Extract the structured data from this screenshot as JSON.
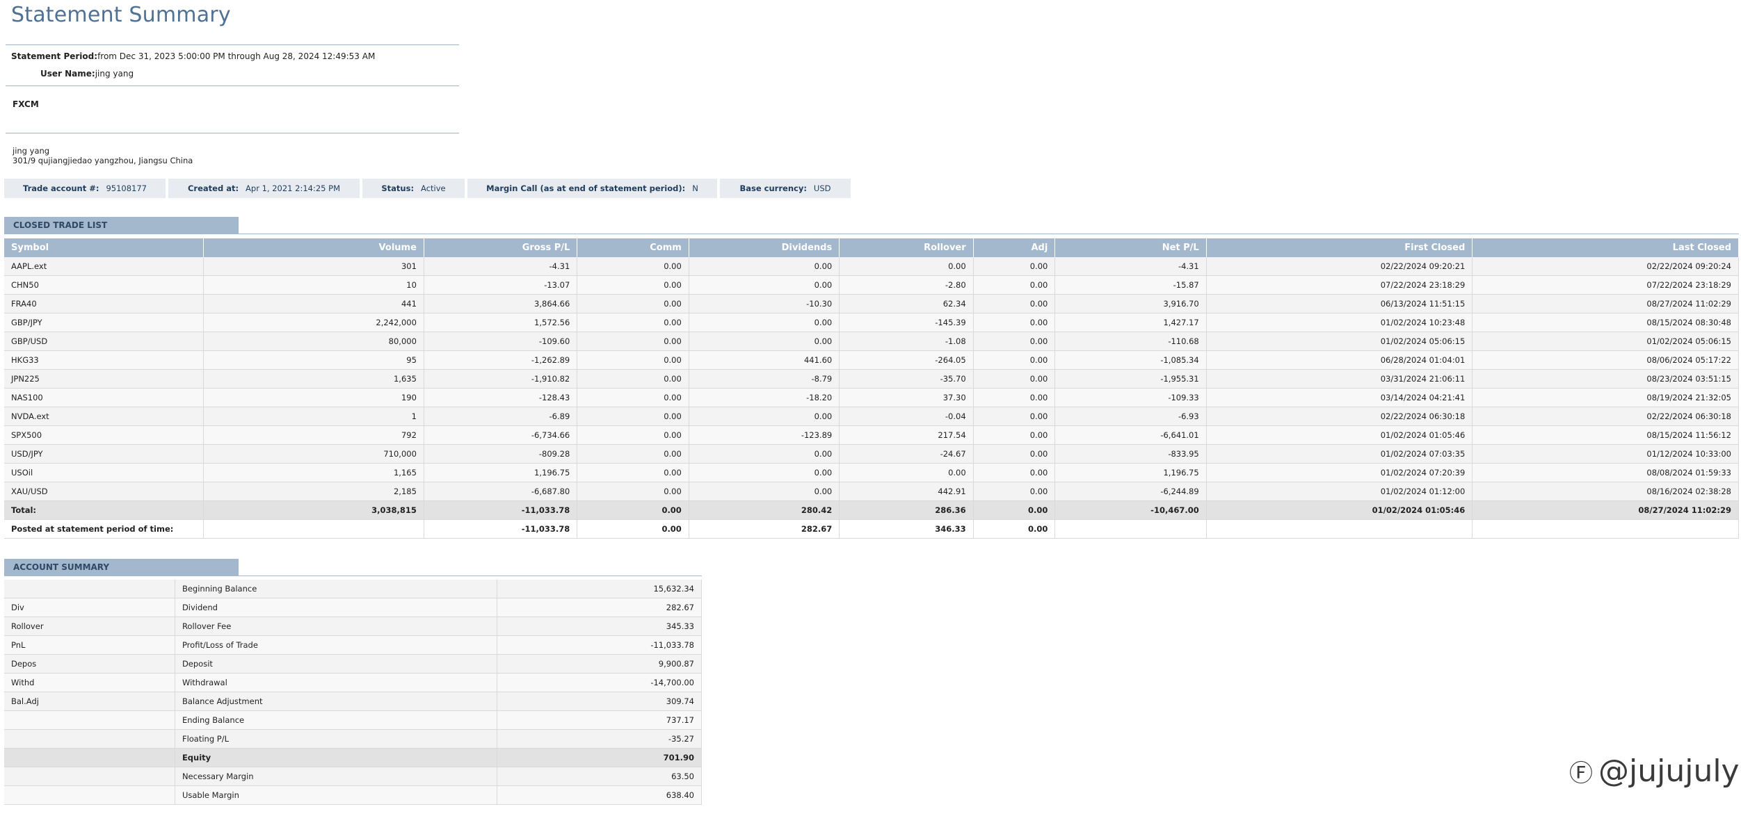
{
  "title": "Statement Summary",
  "statement_period": {
    "label": "Statement Period:",
    "value": "from Dec 31, 2023 5:00:00 PM through Aug 28, 2024 12:49:53 AM"
  },
  "user_name": {
    "label": "User Name:",
    "value": "jing yang"
  },
  "broker": "FXCM",
  "address": {
    "line1": "jing yang",
    "line2": "301/9 qujiangjiedao yangzhou, Jiangsu China"
  },
  "info": [
    {
      "label": "Trade account #:",
      "value": "95108177"
    },
    {
      "label": "Created at:",
      "value": "Apr 1, 2021 2:14:25 PM"
    },
    {
      "label": "Status:",
      "value": "Active"
    },
    {
      "label": "Margin Call (as at end of statement period):",
      "value": "N"
    },
    {
      "label": "Base currency:",
      "value": "USD"
    }
  ],
  "closed_trade_list": {
    "heading": "CLOSED TRADE LIST",
    "columns": [
      "Symbol",
      "Volume",
      "Gross P/L",
      "Comm",
      "Dividends",
      "Rollover",
      "Adj",
      "Net P/L",
      "First Closed",
      "Last Closed"
    ],
    "rows": [
      [
        "AAPL.ext",
        "301",
        "-4.31",
        "0.00",
        "0.00",
        "0.00",
        "0.00",
        "-4.31",
        "02/22/2024 09:20:21",
        "02/22/2024 09:20:24"
      ],
      [
        "CHN50",
        "10",
        "-13.07",
        "0.00",
        "0.00",
        "-2.80",
        "0.00",
        "-15.87",
        "07/22/2024 23:18:29",
        "07/22/2024 23:18:29"
      ],
      [
        "FRA40",
        "441",
        "3,864.66",
        "0.00",
        "-10.30",
        "62.34",
        "0.00",
        "3,916.70",
        "06/13/2024 11:51:15",
        "08/27/2024 11:02:29"
      ],
      [
        "GBP/JPY",
        "2,242,000",
        "1,572.56",
        "0.00",
        "0.00",
        "-145.39",
        "0.00",
        "1,427.17",
        "01/02/2024 10:23:48",
        "08/15/2024 08:30:48"
      ],
      [
        "GBP/USD",
        "80,000",
        "-109.60",
        "0.00",
        "0.00",
        "-1.08",
        "0.00",
        "-110.68",
        "01/02/2024 05:06:15",
        "01/02/2024 05:06:15"
      ],
      [
        "HKG33",
        "95",
        "-1,262.89",
        "0.00",
        "441.60",
        "-264.05",
        "0.00",
        "-1,085.34",
        "06/28/2024 01:04:01",
        "08/06/2024 05:17:22"
      ],
      [
        "JPN225",
        "1,635",
        "-1,910.82",
        "0.00",
        "-8.79",
        "-35.70",
        "0.00",
        "-1,955.31",
        "03/31/2024 21:06:11",
        "08/23/2024 03:51:15"
      ],
      [
        "NAS100",
        "190",
        "-128.43",
        "0.00",
        "-18.20",
        "37.30",
        "0.00",
        "-109.33",
        "03/14/2024 04:21:41",
        "08/19/2024 21:32:05"
      ],
      [
        "NVDA.ext",
        "1",
        "-6.89",
        "0.00",
        "0.00",
        "-0.04",
        "0.00",
        "-6.93",
        "02/22/2024 06:30:18",
        "02/22/2024 06:30:18"
      ],
      [
        "SPX500",
        "792",
        "-6,734.66",
        "0.00",
        "-123.89",
        "217.54",
        "0.00",
        "-6,641.01",
        "01/02/2024 01:05:46",
        "08/15/2024 11:56:12"
      ],
      [
        "USD/JPY",
        "710,000",
        "-809.28",
        "0.00",
        "0.00",
        "-24.67",
        "0.00",
        "-833.95",
        "01/02/2024 07:03:35",
        "01/12/2024 10:33:00"
      ],
      [
        "USOil",
        "1,165",
        "1,196.75",
        "0.00",
        "0.00",
        "0.00",
        "0.00",
        "1,196.75",
        "01/02/2024 07:20:39",
        "08/08/2024 01:59:33"
      ],
      [
        "XAU/USD",
        "2,185",
        "-6,687.80",
        "0.00",
        "0.00",
        "442.91",
        "0.00",
        "-6,244.89",
        "01/02/2024 01:12:00",
        "08/16/2024 02:38:28"
      ]
    ],
    "total": [
      "Total:",
      "3,038,815",
      "-11,033.78",
      "0.00",
      "280.42",
      "286.36",
      "0.00",
      "-10,467.00",
      "01/02/2024 01:05:46",
      "08/27/2024 11:02:29"
    ],
    "posted": [
      "Posted at statement period of time:",
      "",
      "-11,033.78",
      "0.00",
      "282.67",
      "346.33",
      "0.00",
      "",
      "",
      ""
    ]
  },
  "account_summary": {
    "heading": "ACCOUNT SUMMARY",
    "rows": [
      {
        "code": "",
        "label": "Beginning Balance",
        "value": "15,632.34"
      },
      {
        "code": "Div",
        "label": "Dividend",
        "value": "282.67"
      },
      {
        "code": "Rollover",
        "label": "Rollover Fee",
        "value": "345.33"
      },
      {
        "code": "PnL",
        "label": "Profit/Loss of Trade",
        "value": "-11,033.78"
      },
      {
        "code": "Depos",
        "label": "Deposit",
        "value": "9,900.87"
      },
      {
        "code": "Withd",
        "label": "Withdrawal",
        "value": "-14,700.00"
      },
      {
        "code": "Bal.Adj",
        "label": "Balance Adjustment",
        "value": "309.74"
      },
      {
        "code": "",
        "label": "Ending Balance",
        "value": "737.17"
      },
      {
        "code": "",
        "label": "Floating P/L",
        "value": "-35.27"
      },
      {
        "code": "",
        "label": "Equity",
        "value": "701.90"
      },
      {
        "code": "",
        "label": "Necessary Margin",
        "value": "63.50"
      },
      {
        "code": "",
        "label": "Usable Margin",
        "value": "638.40"
      }
    ]
  },
  "watermark": "@jujujuly"
}
